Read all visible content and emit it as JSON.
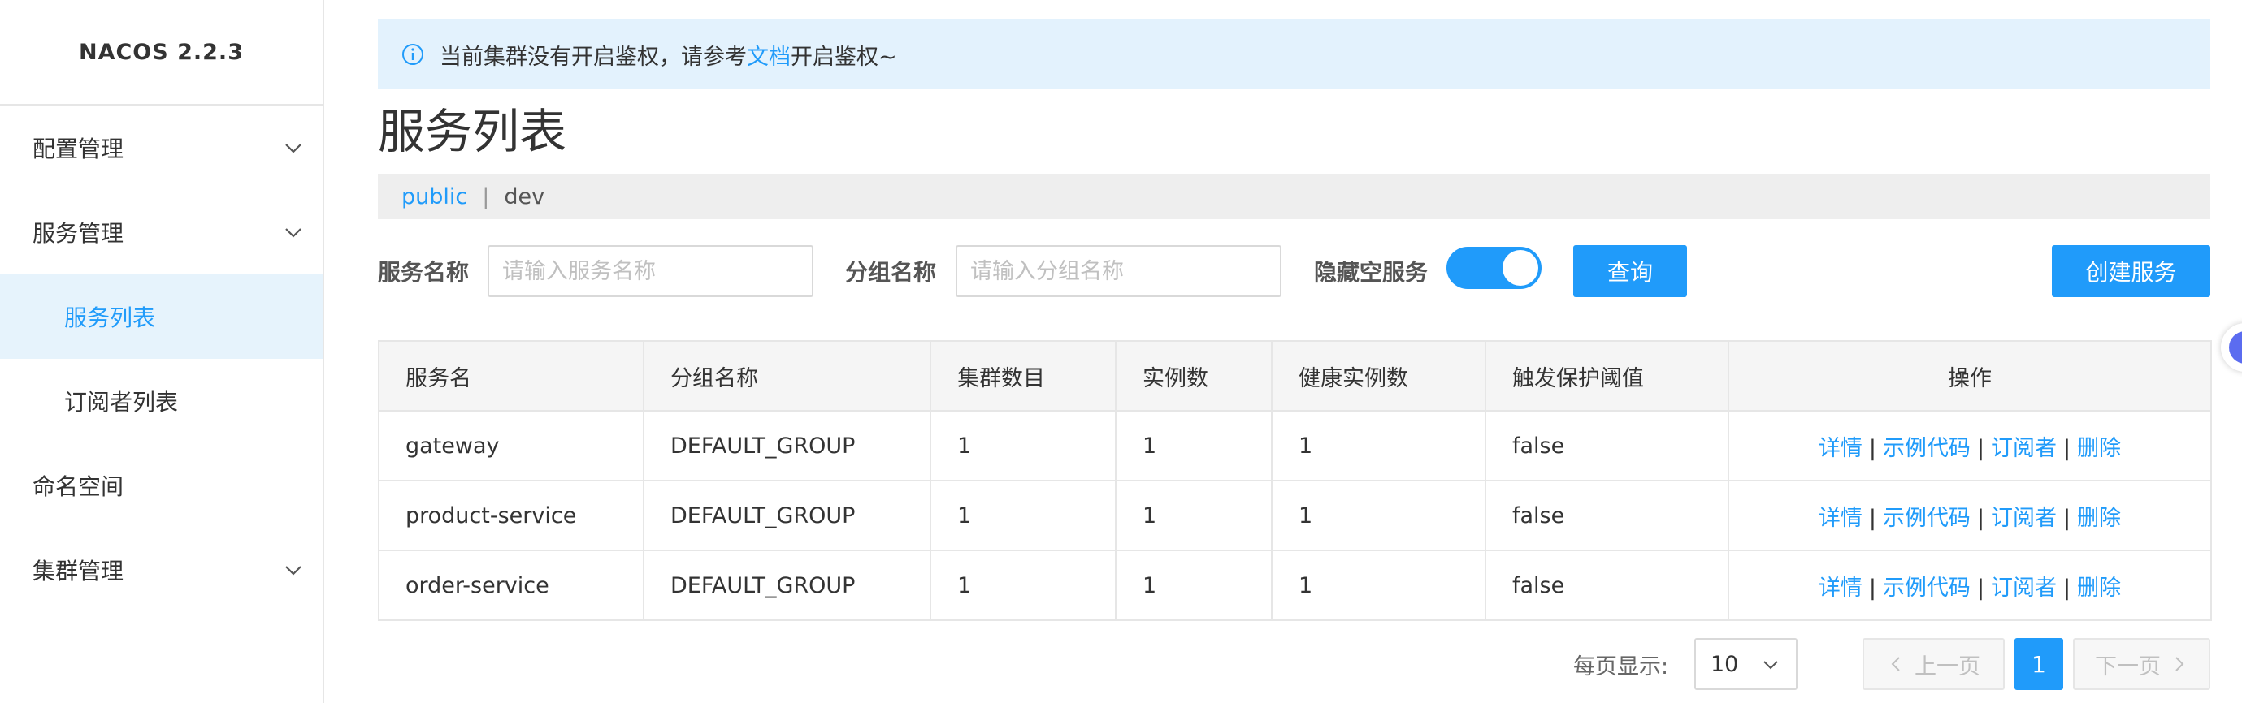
{
  "app": {
    "brand": "NACOS 2.2.3"
  },
  "sidebar": {
    "items": [
      {
        "label": "配置管理",
        "expandable": true
      },
      {
        "label": "服务管理",
        "expandable": true
      },
      {
        "label": "服务列表",
        "active": true
      },
      {
        "label": "订阅者列表"
      },
      {
        "label": "命名空间"
      },
      {
        "label": "集群管理",
        "expandable": true
      }
    ]
  },
  "notice": {
    "text_before": "当前集群没有开启鉴权，请参考",
    "link": "文档",
    "text_after": "开启鉴权~"
  },
  "page": {
    "title": "服务列表"
  },
  "namespaces": {
    "items": [
      "public",
      "dev"
    ],
    "separator": "|",
    "selected": "public"
  },
  "filter": {
    "service_name_label": "服务名称",
    "service_name_placeholder": "请输入服务名称",
    "group_name_label": "分组名称",
    "group_name_placeholder": "请输入分组名称",
    "hide_empty_label": "隐藏空服务",
    "hide_empty_on": true,
    "query_button": "查询",
    "create_button": "创建服务"
  },
  "table": {
    "headers": [
      "服务名",
      "分组名称",
      "集群数目",
      "实例数",
      "健康实例数",
      "触发保护阈值",
      "操作"
    ],
    "rows": [
      {
        "name": "gateway",
        "group": "DEFAULT_GROUP",
        "clusters": "1",
        "instances": "1",
        "healthy": "1",
        "threshold": "false"
      },
      {
        "name": "product-service",
        "group": "DEFAULT_GROUP",
        "clusters": "1",
        "instances": "1",
        "healthy": "1",
        "threshold": "false"
      },
      {
        "name": "order-service",
        "group": "DEFAULT_GROUP",
        "clusters": "1",
        "instances": "1",
        "healthy": "1",
        "threshold": "false"
      }
    ],
    "actions": {
      "detail": "详情",
      "sample_code": "示例代码",
      "subscribers": "订阅者",
      "delete": "删除",
      "separator": "|"
    }
  },
  "pagination": {
    "page_size_label": "每页显示:",
    "page_size": "10",
    "prev": "上一页",
    "current_page": "1",
    "next": "下一页"
  },
  "colors": {
    "primary": "#209bfa",
    "notice_bg": "#e3f2fd",
    "active_bg": "#e6f3fc"
  }
}
